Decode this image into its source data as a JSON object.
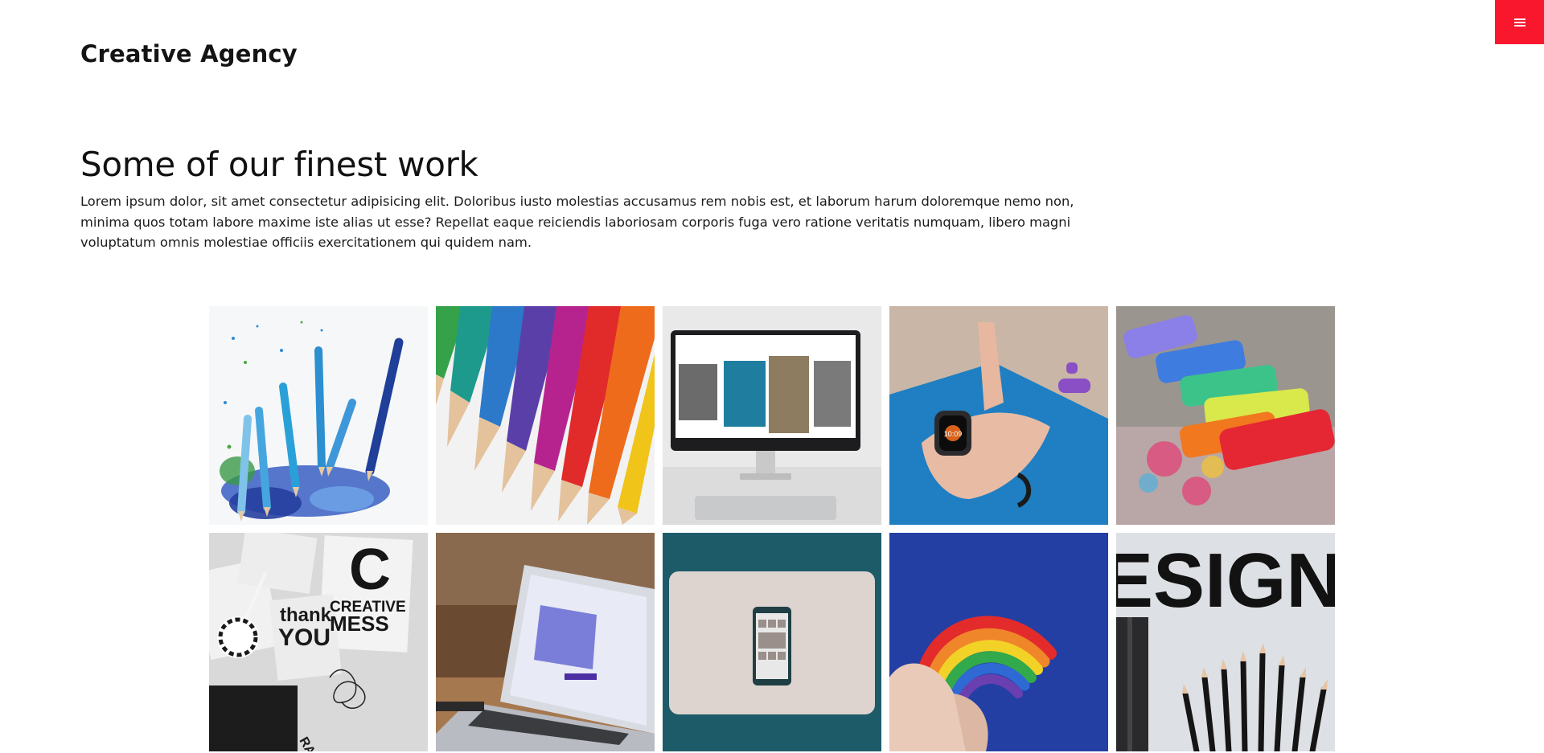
{
  "header": {
    "brand": "Creative Agency",
    "menu_icon": "hamburger-menu-icon",
    "accent_color": "#f8172c"
  },
  "section": {
    "title": "Some of our finest work",
    "description": "Lorem ipsum dolor, sit amet consectetur adipisicing elit. Doloribus iusto molestias accusamus rem nobis est, et laborum harum doloremque nemo non, minima quos totam labore maxime iste alias ut esse? Repellat eaque reiciendis laboriosam corporis fuga vero ratione veritatis numquam, libero magni voluptatum omnis molestiae officiis exercitationem qui quidem nam."
  },
  "gallery": {
    "tile_text": {
      "watch_time": "10:09",
      "creative": "CREATIVE",
      "mess": "MESS",
      "big_c": "C",
      "thank": "thank",
      "you": "YOU",
      "design": "ESIGN",
      "raznia": "RAZNIA"
    }
  }
}
